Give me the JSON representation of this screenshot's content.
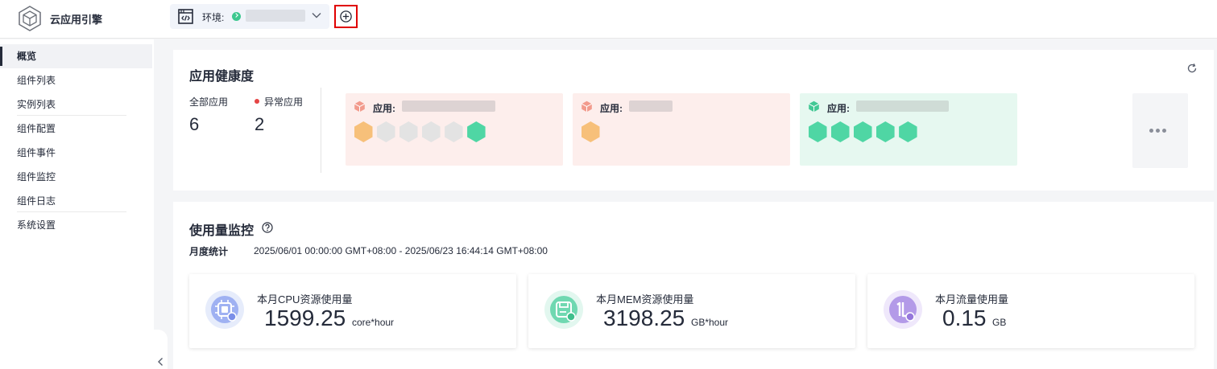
{
  "app": {
    "name": "云应用引擎"
  },
  "environment": {
    "label": "环境:"
  },
  "sidebar": {
    "items": [
      {
        "label": "概览",
        "active": true
      },
      {
        "label": "组件列表"
      },
      {
        "label": "实例列表"
      },
      {
        "label": "组件配置"
      },
      {
        "label": "组件事件"
      },
      {
        "label": "组件监控"
      },
      {
        "label": "组件日志"
      },
      {
        "label": "系统设置"
      }
    ]
  },
  "health": {
    "title": "应用健康度",
    "total_label": "全部应用",
    "total_value": "6",
    "abnormal_label": "异常应用",
    "abnormal_value": "2",
    "tiles": [
      {
        "label": "应用:",
        "status": "abnormal",
        "hexes": [
          "warning",
          "idle",
          "idle",
          "idle",
          "idle",
          "healthy"
        ]
      },
      {
        "label": "应用:",
        "status": "abnormal",
        "hexes": [
          "warning"
        ]
      },
      {
        "label": "应用:",
        "status": "healthy",
        "hexes": [
          "healthy",
          "healthy",
          "healthy",
          "healthy",
          "healthy"
        ]
      }
    ]
  },
  "usage": {
    "title": "使用量监控",
    "monthly_label": "月度统计",
    "monthly_range": "2025/06/01 00:00:00 GMT+08:00 - 2025/06/23 16:44:14 GMT+08:00",
    "metrics": [
      {
        "label": "本月CPU资源使用量",
        "value": "1599.25",
        "unit": "core*hour",
        "icon": "cpu-chip-icon"
      },
      {
        "label": "本月MEM资源使用量",
        "value": "3198.25",
        "unit": "GB*hour",
        "icon": "memory-icon"
      },
      {
        "label": "本月流量使用量",
        "value": "0.15",
        "unit": "GB",
        "icon": "traffic-icon"
      }
    ]
  },
  "colors": {
    "warning_hex": "#f7c07a",
    "idle_hex": "#e3e3e3",
    "healthy_hex": "#4fd6a4",
    "accent_red": "#e00000"
  }
}
